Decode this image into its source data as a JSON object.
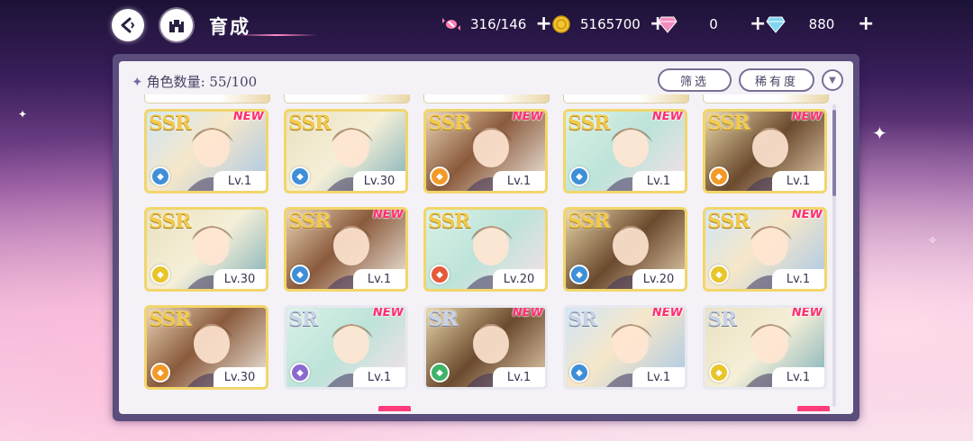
{
  "header": {
    "title": "育成",
    "resources": [
      {
        "name": "candy",
        "icon": "candy-icon",
        "value": "316/146"
      },
      {
        "name": "coin",
        "icon": "coin-icon",
        "value": "5165700"
      },
      {
        "name": "pink-diamond",
        "icon": "pink-diamond-icon",
        "value": "0"
      },
      {
        "name": "blue-diamond",
        "icon": "blue-diamond-icon",
        "value": "880"
      }
    ],
    "plus": "+"
  },
  "panel": {
    "count_label": "角色数量:",
    "count_value": "55/100",
    "filter_label": "筛选",
    "rarity_label": "稀有度"
  },
  "colors": {
    "ssr_frame": "#f2d66b",
    "sr_frame": "#e8e8f0",
    "new_tag": "#ff2d72",
    "attr_blue": "#3f8fd8",
    "attr_orange": "#f29a28",
    "attr_yellow": "#e8c62a",
    "attr_red": "#e45a3a",
    "attr_purple": "#8a6ad0",
    "attr_green": "#3fb36a"
  },
  "cards": [
    {
      "rarity": "SSR",
      "new": "NEW",
      "level": "Lv.1",
      "attr": "blue"
    },
    {
      "rarity": "SSR",
      "new": "",
      "level": "Lv.30",
      "attr": "blue"
    },
    {
      "rarity": "SSR",
      "new": "NEW",
      "level": "Lv.1",
      "attr": "orange"
    },
    {
      "rarity": "SSR",
      "new": "NEW",
      "level": "Lv.1",
      "attr": "blue"
    },
    {
      "rarity": "SSR",
      "new": "NEW",
      "level": "Lv.1",
      "attr": "orange"
    },
    {
      "rarity": "SSR",
      "new": "",
      "level": "Lv.30",
      "attr": "yellow"
    },
    {
      "rarity": "SSR",
      "new": "NEW",
      "level": "Lv.1",
      "attr": "blue"
    },
    {
      "rarity": "SSR",
      "new": "",
      "level": "Lv.20",
      "attr": "red"
    },
    {
      "rarity": "SSR",
      "new": "",
      "level": "Lv.20",
      "attr": "blue"
    },
    {
      "rarity": "SSR",
      "new": "NEW",
      "level": "Lv.1",
      "attr": "yellow"
    },
    {
      "rarity": "SSR",
      "new": "",
      "level": "Lv.30",
      "attr": "orange"
    },
    {
      "rarity": "SR",
      "new": "NEW",
      "level": "Lv.1",
      "attr": "purple"
    },
    {
      "rarity": "SR",
      "new": "NEW",
      "level": "Lv.1",
      "attr": "green"
    },
    {
      "rarity": "SR",
      "new": "NEW",
      "level": "Lv.1",
      "attr": "blue"
    },
    {
      "rarity": "SR",
      "new": "NEW",
      "level": "Lv.1",
      "attr": "yellow"
    }
  ]
}
